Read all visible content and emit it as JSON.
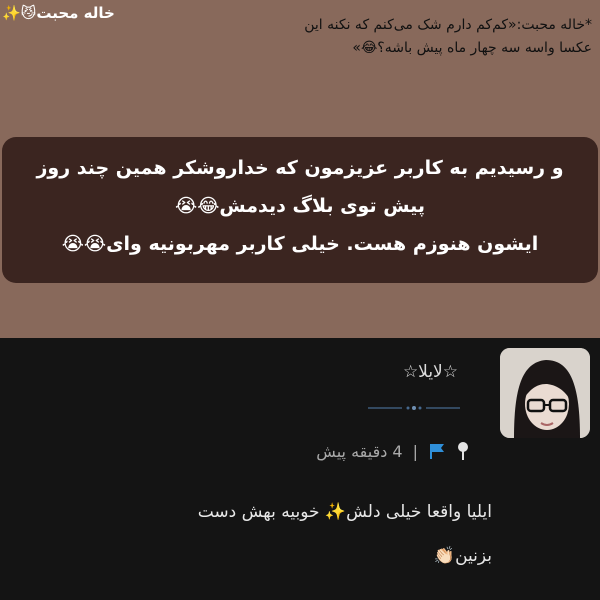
{
  "brand": {
    "tag": "خاله محبت😼✨"
  },
  "quote": {
    "line1": "*خاله محبت:«کم‌کم دارم شک می‌کنم که نکنه این",
    "line2": "عکسا واسه سه چهار ماه پیش باشه؟😂»"
  },
  "caption": {
    "line1": "و رسیدیم به کاربر عزیزمون که خداروشکر همین چند روز",
    "line2": "پیش توی بلاگ دیدمش😂😭",
    "line3": "ایشون هنوزم هست. خیلی کاربر مهربونیه وای😭😭"
  },
  "comment_card": {
    "username": "☆لایلا☆",
    "time_ago": "4 دقیقه پیش",
    "separator": "|",
    "body_line1": "ایلیا واقعا خیلی دلش✨ خوبیه بهش دست",
    "body_line2": "بزنین👏🏻"
  },
  "icons": {
    "avatar": "user-avatar-photo",
    "flag": "flag-icon",
    "pin": "pin-icon",
    "divider": "ornament-divider"
  },
  "colors": {
    "top_background": "#88695b",
    "caption_box": "#3b2520",
    "panel_background": "#141414",
    "flag_blue": "#2f8fd9",
    "divider_blue": "#46698e"
  }
}
